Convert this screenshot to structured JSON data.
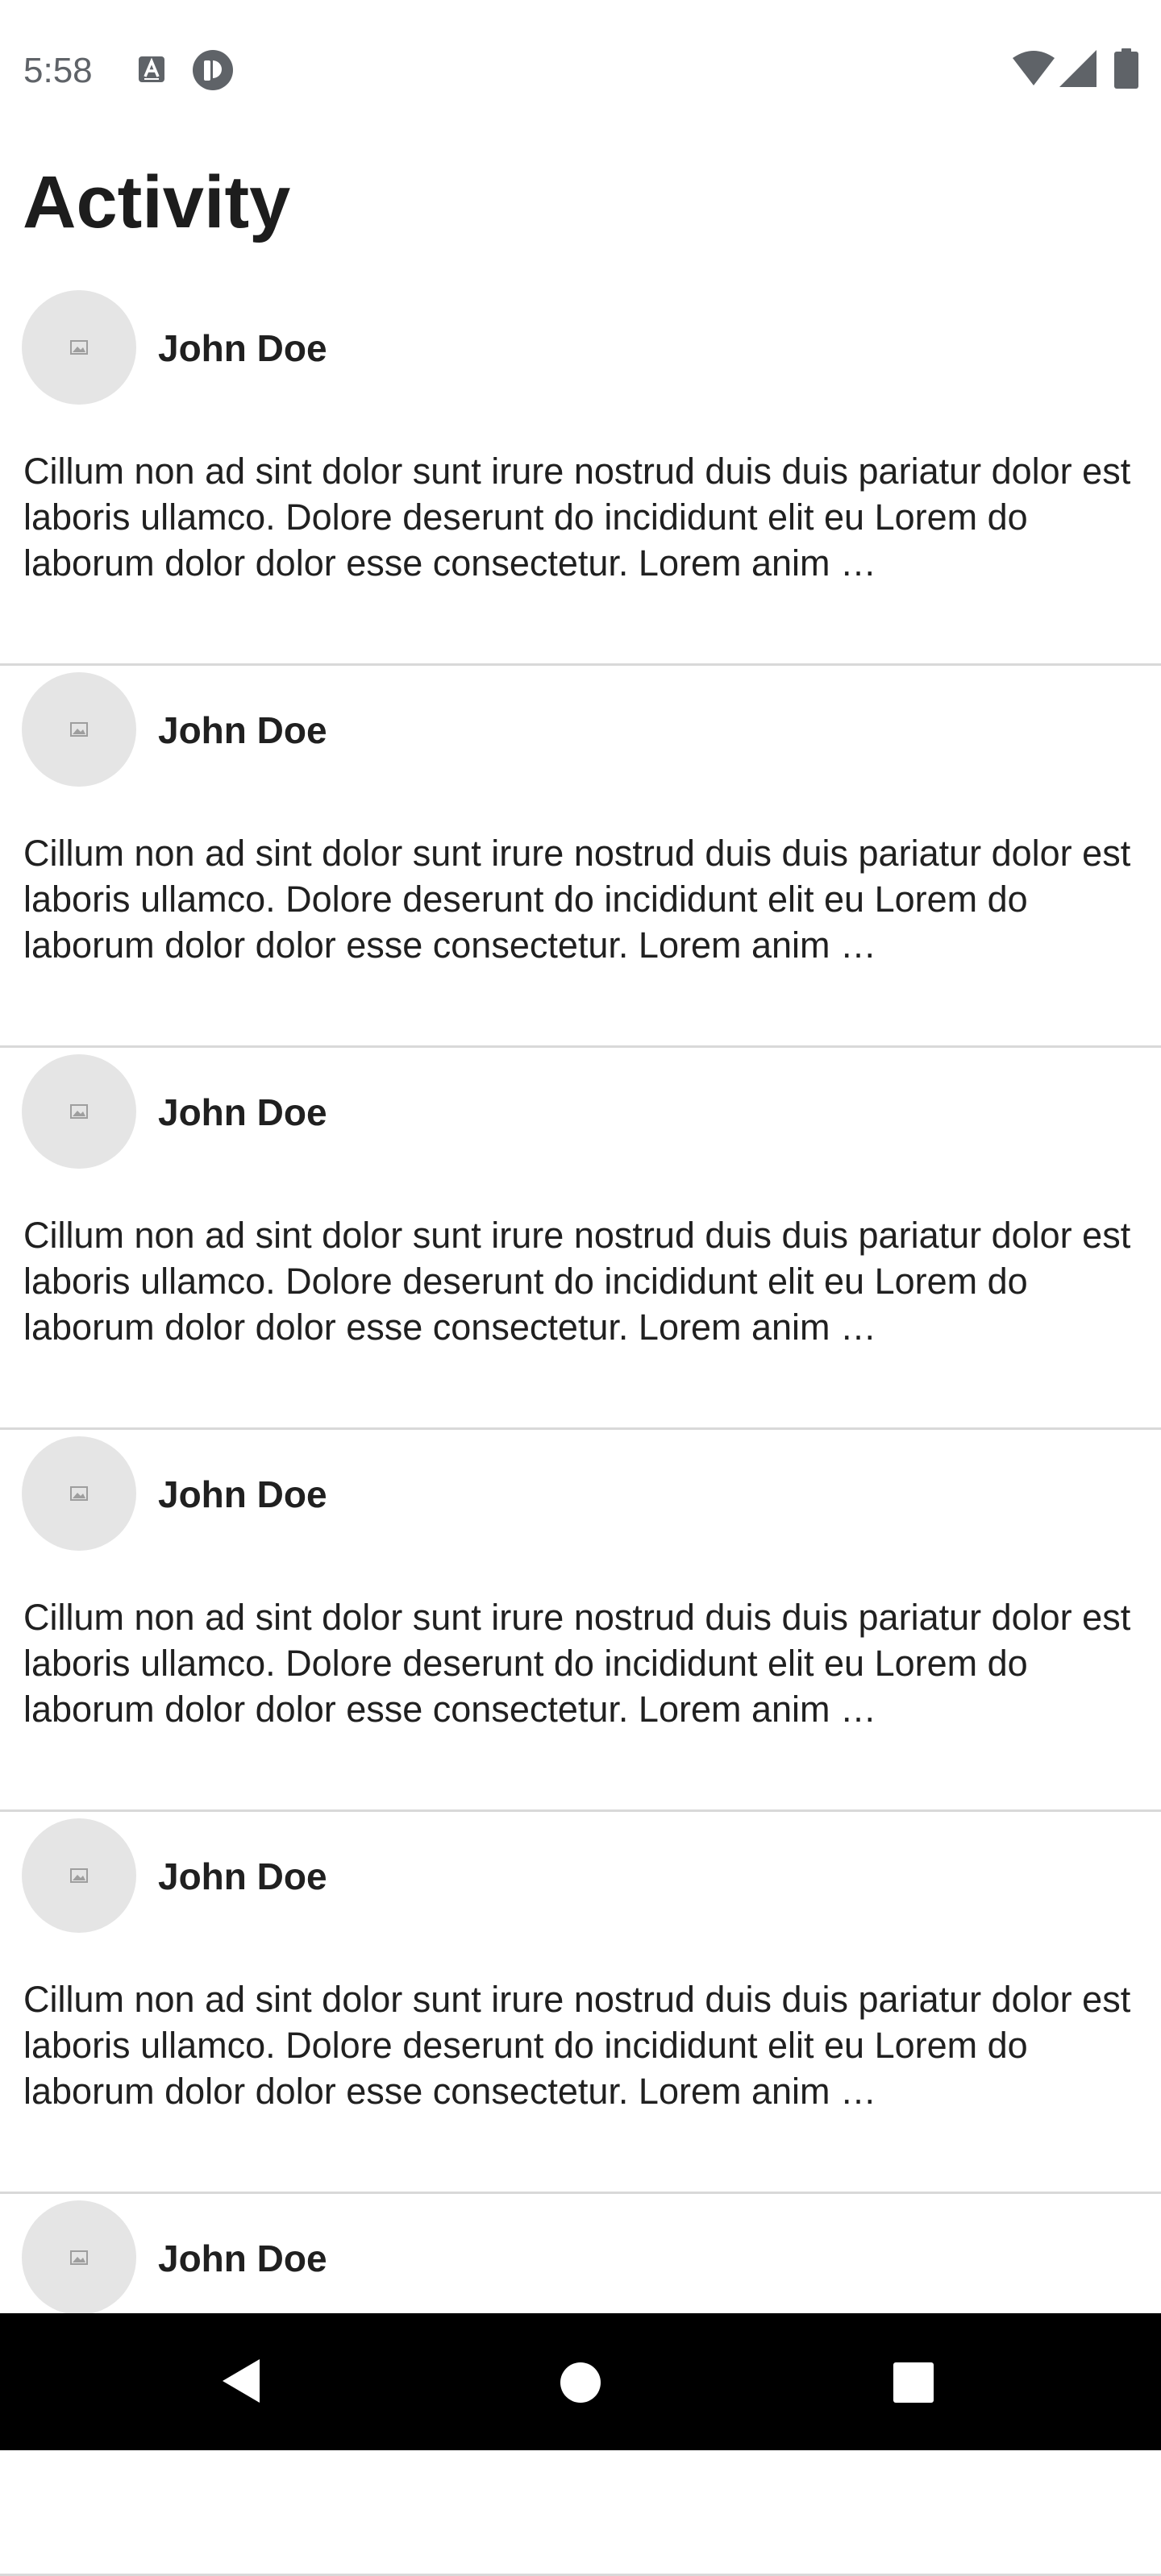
{
  "status_bar": {
    "time": "5:58",
    "icons": [
      "text-input-icon",
      "notification-app-icon",
      "wifi-icon",
      "cell-signal-icon",
      "battery-icon"
    ]
  },
  "page": {
    "title": "Activity"
  },
  "feed": {
    "items": [
      {
        "author": "John Doe",
        "avatar_icon": "image-placeholder-icon",
        "text": "Cillum non ad sint dolor sunt irure nostrud duis duis pariatur dolor est laboris ullamco. Dolore deserunt do incididunt elit eu Lorem do laborum dolor dolor esse consectetur. Lorem anim …"
      },
      {
        "author": "John Doe",
        "avatar_icon": "image-placeholder-icon",
        "text": "Cillum non ad sint dolor sunt irure nostrud duis duis pariatur dolor est laboris ullamco. Dolore deserunt do incididunt elit eu Lorem do laborum dolor dolor esse consectetur. Lorem anim …"
      },
      {
        "author": "John Doe",
        "avatar_icon": "image-placeholder-icon",
        "text": "Cillum non ad sint dolor sunt irure nostrud duis duis pariatur dolor est laboris ullamco. Dolore deserunt do incididunt elit eu Lorem do laborum dolor dolor esse consectetur. Lorem anim …"
      },
      {
        "author": "John Doe",
        "avatar_icon": "image-placeholder-icon",
        "text": "Cillum non ad sint dolor sunt irure nostrud duis duis pariatur dolor est laboris ullamco. Dolore deserunt do incididunt elit eu Lorem do laborum dolor dolor esse consectetur. Lorem anim …"
      },
      {
        "author": "John Doe",
        "avatar_icon": "image-placeholder-icon",
        "text": "Cillum non ad sint dolor sunt irure nostrud duis duis pariatur dolor est laboris ullamco. Dolore deserunt do incididunt elit eu Lorem do laborum dolor dolor esse consectetur. Lorem anim …"
      },
      {
        "author": "John Doe",
        "avatar_icon": "image-placeholder-icon",
        "text": ""
      }
    ]
  },
  "nav_bar": {
    "icons": [
      "back-icon",
      "home-icon",
      "recents-icon"
    ]
  },
  "colors": {
    "background": "#ffffff",
    "text": "#202020",
    "divider": "#d9d9d9",
    "avatar_bg": "#e5e5e5",
    "status_text": "#5f6368",
    "nav_bar": "#000000"
  }
}
